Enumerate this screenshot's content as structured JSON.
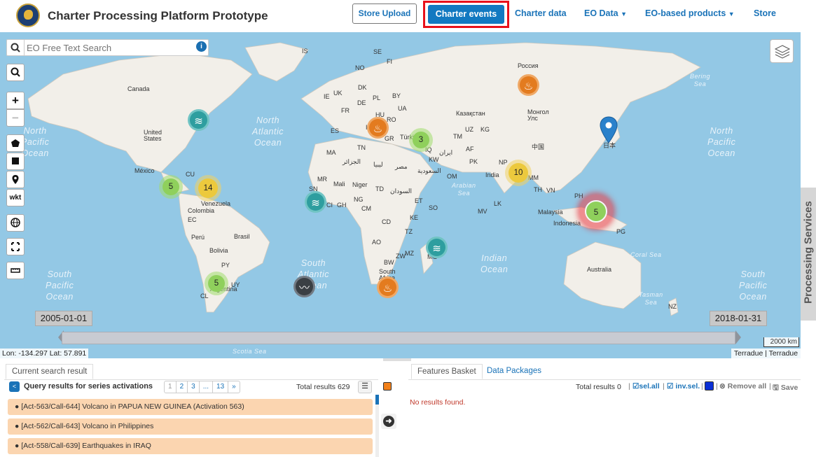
{
  "header": {
    "app_title": "Charter Processing Platform Prototype",
    "nav": {
      "store_upload": "Store Upload",
      "charter_events": "Charter events",
      "charter_data": "Charter data",
      "eo_data": "EO Data",
      "eo_products": "EO-based products",
      "store": "Store"
    }
  },
  "map": {
    "search_placeholder": "EO Free Text Search",
    "tools": {
      "wkt": "wkt",
      "zoom_in": "+",
      "zoom_out": "−"
    },
    "date_start": "2005-01-01",
    "date_end": "2018-01-31",
    "coords": "Lon: -134.297 Lat: 57.891",
    "scale": "2000 km",
    "attribution": "Terradue | Terradue",
    "processing_tab": "Processing Services",
    "ocean_labels": [
      {
        "id": "na",
        "text": "North\nAtlantic\nOcean"
      },
      {
        "id": "np-left",
        "text": "North\nPacific\nOcean"
      },
      {
        "id": "np-right",
        "text": "North\nPacific\nOcean"
      },
      {
        "id": "sa",
        "text": "South\nAtlantic\nOcean"
      },
      {
        "id": "sp-left",
        "text": "South\nPacific\nOcean"
      },
      {
        "id": "sp-right",
        "text": "South\nPacific\nOcean"
      },
      {
        "id": "io",
        "text": "Indian\nOcean"
      },
      {
        "id": "scotia",
        "text": "Scotia Sea"
      },
      {
        "id": "coral",
        "text": "Coral Sea"
      },
      {
        "id": "tasman",
        "text": "Tasman\nSea"
      },
      {
        "id": "bering",
        "text": "Bering\nSea"
      },
      {
        "id": "arabian",
        "text": "Arabian\nSea"
      }
    ],
    "country_labels": [
      "Canada",
      "United States",
      "México",
      "CU",
      "Venezuela",
      "Colombia",
      "EC",
      "Perú",
      "Bolivia",
      "Brasil",
      "PY",
      "UY",
      "Argentina",
      "CL",
      "IS",
      "SE",
      "NO",
      "FI",
      "UK",
      "DK",
      "IE",
      "BY",
      "PL",
      "DE",
      "UA",
      "FR",
      "HU",
      "RO",
      "ES",
      "IT",
      "GR",
      "Türkiye",
      "TN",
      "MA",
      "الجزائر",
      "ليبيا",
      "مصر",
      "السعودية",
      "OM",
      "MR",
      "Mali",
      "Niger",
      "TD",
      "السودان",
      "SN",
      "CI",
      "GH",
      "NG",
      "CM",
      "ET",
      "SO",
      "KE",
      "TZ",
      "CD",
      "AO",
      "ZW",
      "MZ",
      "MG",
      "BW",
      "South Africa",
      "Россия",
      "Казақстан",
      "TM",
      "UZ",
      "KG",
      "AF",
      "IR",
      "IQ",
      "KW",
      "PK",
      "NP",
      "India",
      "LK",
      "MV",
      "MM",
      "TH",
      "VN",
      "PH",
      "中国",
      "Монгол Улс",
      "日本",
      "Malaysia",
      "Indonesia",
      "PG",
      "Australia",
      "NZ"
    ],
    "clusters": [
      {
        "id": "c-americas-5",
        "count": "5"
      },
      {
        "id": "c-americas-14",
        "count": "14"
      },
      {
        "id": "c-turkey-3",
        "count": "3"
      },
      {
        "id": "c-india-10",
        "count": "10"
      },
      {
        "id": "c-indonesia-5",
        "count": "5"
      },
      {
        "id": "c-argentina-5",
        "count": "5"
      }
    ]
  },
  "bottom": {
    "left_tab": "Current search result",
    "query_title": "Query results for series activations",
    "pager": [
      "1",
      "2",
      "3",
      "...",
      "13",
      "»"
    ],
    "total_label": "Total results",
    "total_value": "629",
    "results": [
      "[Act-563/Call-644] Volcano in PAPUA NEW GUINEA (Activation 563)",
      "[Act-562/Call-643] Volcano in Philippines",
      "[Act-558/Call-639] Earthquakes in IRAQ"
    ],
    "right_tabs": {
      "features": "Features Basket",
      "packages": "Data Packages"
    },
    "fb_total_label": "Total results",
    "fb_total_value": "0",
    "sel_all": "sel.all",
    "inv_sel": "inv.sel.",
    "remove_all": "Remove all",
    "save": "Save",
    "no_results": "No results found."
  },
  "colors": {
    "accent": "#1279c1",
    "highlight_border": "#e8111b",
    "result_bg": "#fbd5b0",
    "ocean": "#93c8e5",
    "land": "#f2efe9"
  }
}
